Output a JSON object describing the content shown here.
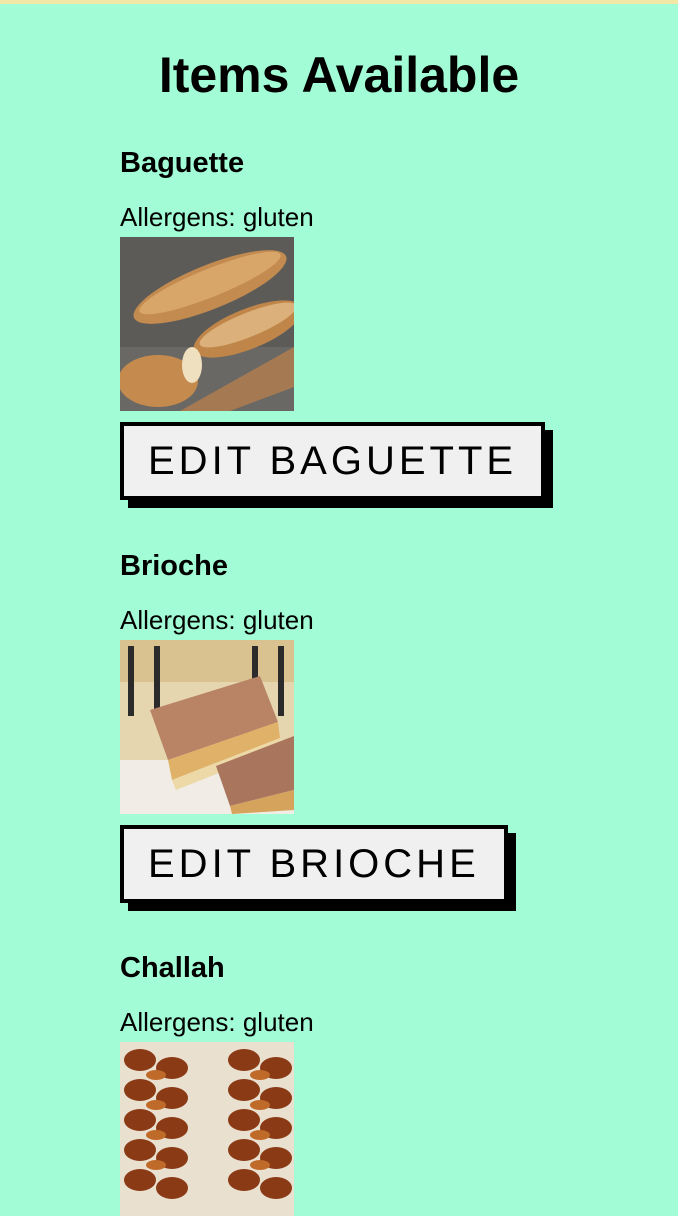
{
  "page": {
    "title": "Items Available"
  },
  "items": [
    {
      "name": "Baguette",
      "allergens": "Allergens: gluten",
      "image": "baguette-photo",
      "edit_label": "EDIT BAGUETTE"
    },
    {
      "name": "Brioche",
      "allergens": "Allergens: gluten",
      "image": "caramel-shortbread-photo",
      "edit_label": "EDIT BRIOCHE"
    },
    {
      "name": "Challah",
      "allergens": "Allergens: gluten",
      "image": "challah-photo"
    }
  ],
  "colors": {
    "background": "#a2fcd6",
    "button_bg": "#f0f0f0",
    "button_border": "#000000"
  }
}
